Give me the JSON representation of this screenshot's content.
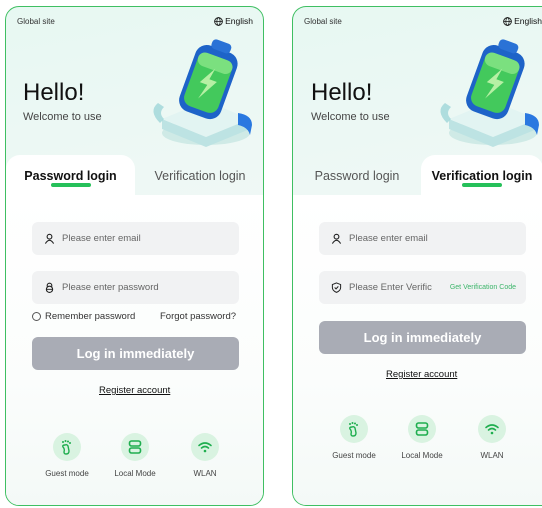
{
  "colors": {
    "accent": "#26c05a",
    "button_bg": "#a9acb5",
    "field_bg": "#f1f2f3",
    "icon_bg": "#d9f3e1"
  },
  "screens": [
    {
      "global_site": "Global site",
      "language": "English",
      "hello": "Hello!",
      "welcome": "Welcome to use",
      "tabs": [
        {
          "label": "Password login",
          "active": true
        },
        {
          "label": "Verification login",
          "active": false
        }
      ],
      "email_placeholder": "Please enter email",
      "password_placeholder": "Please enter password",
      "remember": "Remember password",
      "forgot": "Forgot password?",
      "login_button": "Log in immediately",
      "register": "Register account",
      "modes": [
        {
          "label": "Guest mode",
          "icon": "footprint-icon"
        },
        {
          "label": "Local Mode",
          "icon": "server-icon"
        },
        {
          "label": "WLAN",
          "icon": "wifi-icon"
        }
      ]
    },
    {
      "global_site": "Global site",
      "language": "English",
      "hello": "Hello!",
      "welcome": "Welcome to use",
      "tabs": [
        {
          "label": "Password login",
          "active": false
        },
        {
          "label": "Verification login",
          "active": true
        }
      ],
      "email_placeholder": "Please enter email",
      "code_placeholder": "Please Enter Verific",
      "get_code": "Get Verification Code",
      "login_button": "Log in immediately",
      "register": "Register account",
      "modes": [
        {
          "label": "Guest mode",
          "icon": "footprint-icon"
        },
        {
          "label": "Local Mode",
          "icon": "server-icon"
        },
        {
          "label": "WLAN",
          "icon": "wifi-icon"
        }
      ]
    }
  ]
}
